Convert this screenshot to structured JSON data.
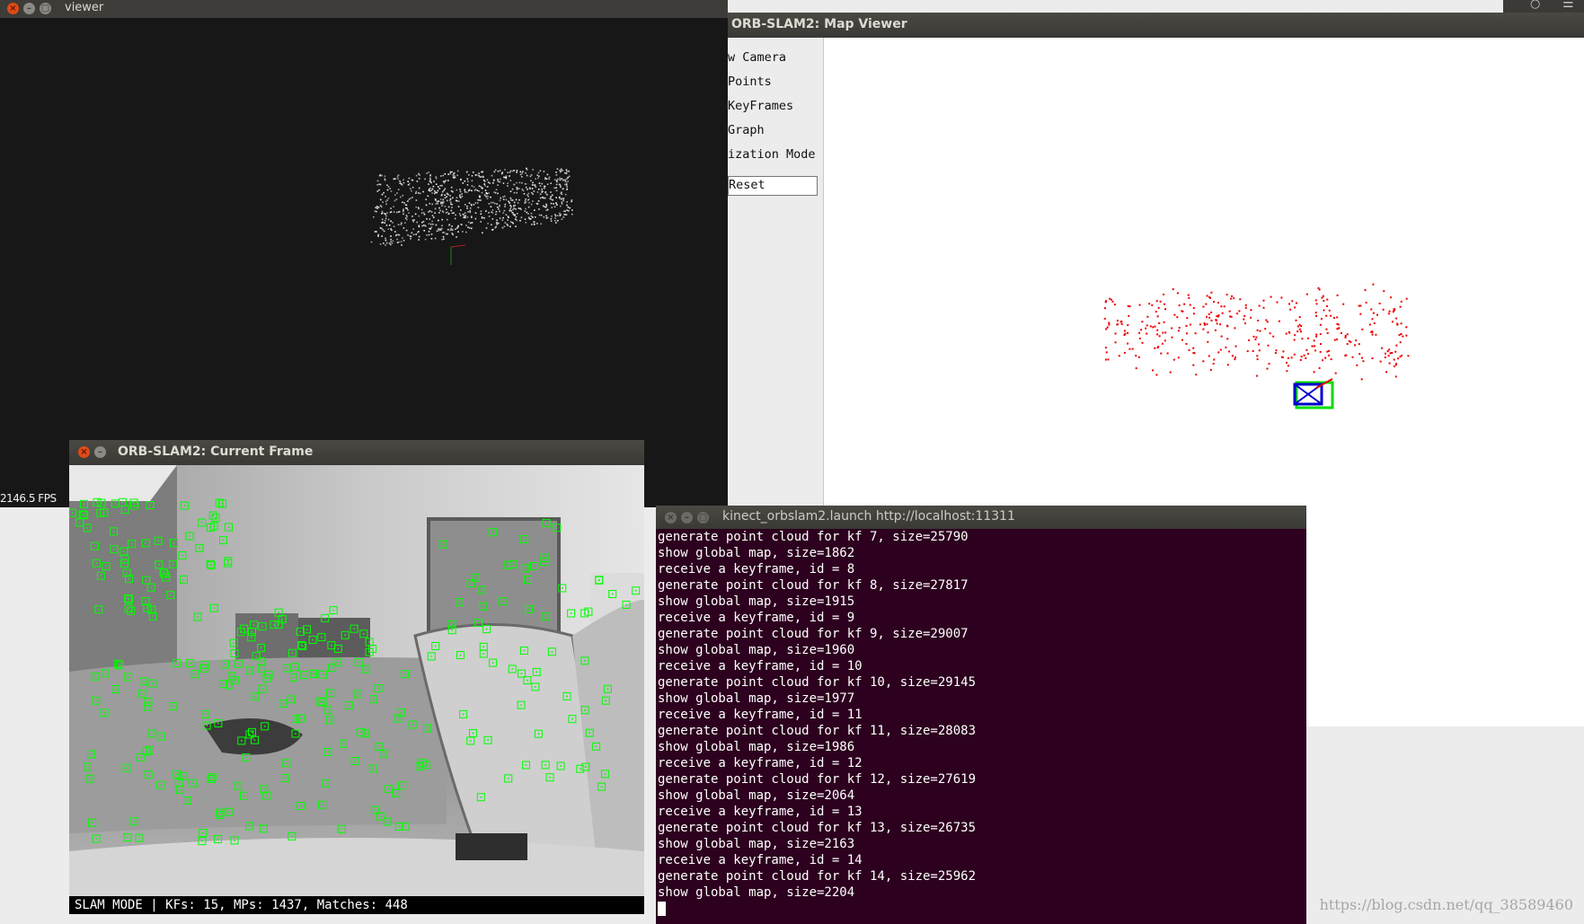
{
  "windows": {
    "viewer": {
      "title": "viewer",
      "fps": "2146.5 FPS"
    },
    "map_viewer": {
      "title": "ORB-SLAM2: Map Viewer",
      "menu_items": [
        "w Camera",
        "Points",
        "KeyFrames",
        "Graph",
        "ization Mode"
      ],
      "reset_label": "Reset"
    },
    "current_frame": {
      "title": "ORB-SLAM2: Current Frame",
      "status": "SLAM MODE |  KFs: 15, MPs: 1437, Matches: 448"
    },
    "terminal": {
      "title": "kinect_orbslam2.launch http://localhost:11311",
      "lines": [
        "generate point cloud for kf 7, size=25790",
        "show global map, size=1862",
        "receive a keyframe, id = 8",
        "generate point cloud for kf 8, size=27817",
        "show global map, size=1915",
        "receive a keyframe, id = 9",
        "generate point cloud for kf 9, size=29007",
        "show global map, size=1960",
        "receive a keyframe, id = 10",
        "generate point cloud for kf 10, size=29145",
        "show global map, size=1977",
        "receive a keyframe, id = 11",
        "generate point cloud for kf 11, size=28083",
        "show global map, size=1986",
        "receive a keyframe, id = 12",
        "generate point cloud for kf 12, size=27619",
        "show global map, size=2064",
        "receive a keyframe, id = 13",
        "generate point cloud for kf 13, size=26735",
        "show global map, size=2163",
        "receive a keyframe, id = 14",
        "generate point cloud for kf 14, size=25962",
        "show global map, size=2204"
      ]
    }
  },
  "watermark": "https://blog.csdn.net/qq_38589460",
  "colors": {
    "terminal_bg": "#2c001e",
    "map_point": "#ee0000",
    "feature_box": "#00ff00",
    "keyframe": "#0000cc"
  }
}
